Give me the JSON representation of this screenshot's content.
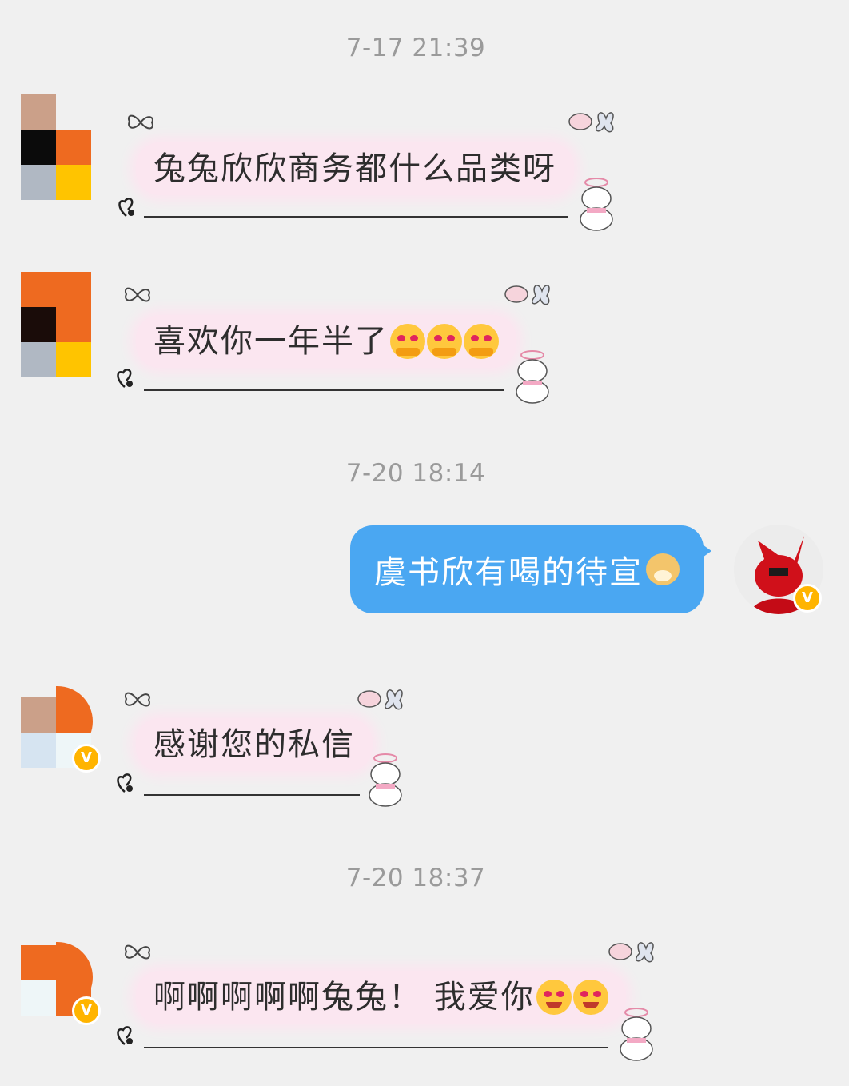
{
  "timestamps": [
    "7-17 21:39",
    "7-20 18:14",
    "7-20 18:37"
  ],
  "messages": [
    {
      "side": "received",
      "text": "兔兔欣欣商务都什么品类呀",
      "emojis": []
    },
    {
      "side": "received",
      "text": "喜欢你一年半了",
      "emojis": [
        "hug-emoji",
        "hug-emoji",
        "hug-emoji"
      ]
    },
    {
      "side": "sent",
      "text": "虞书欣有喝的待宣",
      "emojis": [
        "doge-emoji"
      ]
    },
    {
      "side": "received",
      "text": "感谢您的私信",
      "emojis": []
    },
    {
      "side": "received",
      "text": "啊啊啊啊啊兔兔！ 我爱你",
      "emojis": [
        "heart-eyes-emoji",
        "heart-eyes-emoji"
      ]
    }
  ],
  "badges": {
    "verified": "V"
  },
  "colors": {
    "page_bg": "#f0f0f0",
    "received_bubble": "#fbe6f0",
    "sent_bubble": "#4aa7f2",
    "timestamp": "#9a9a9a",
    "badge": "#ffb400"
  }
}
